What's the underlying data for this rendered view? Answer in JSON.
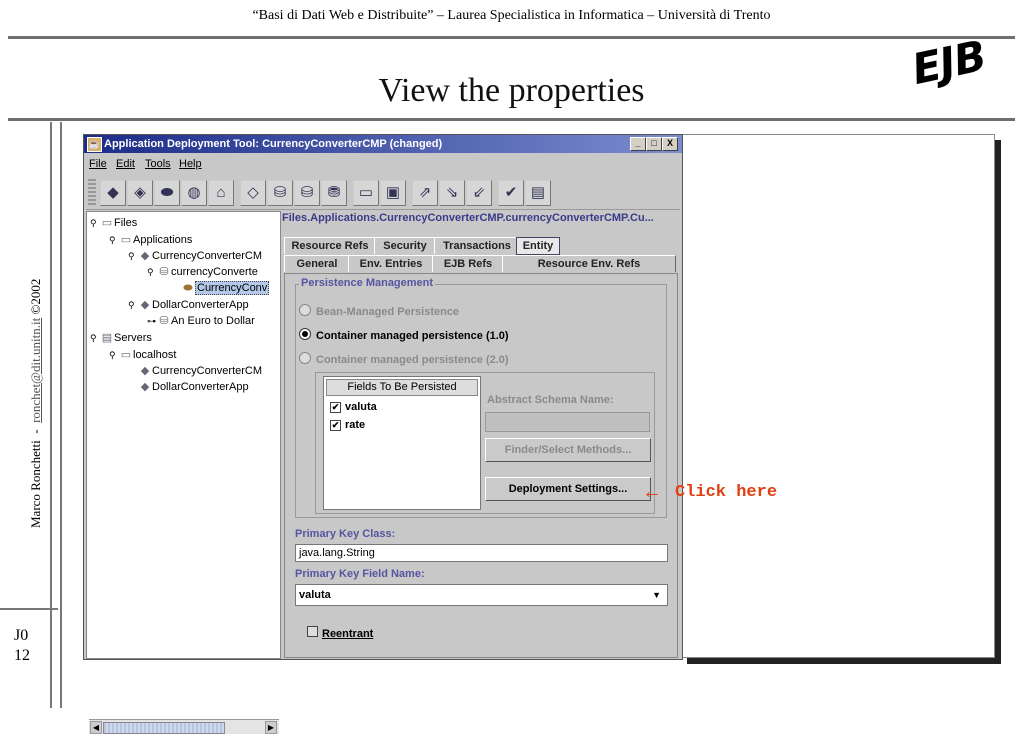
{
  "slide": {
    "course_header": "“Basi di Dati Web e Distribuite” – Laurea Specialistica in Informatica – Università di Trento",
    "title": "View the properties",
    "logo": "EJB",
    "author": "Marco Ronchetti",
    "author_email": "ronchet@dit.unitn.it",
    "copyright": "©2002",
    "separator": "-",
    "code_line1": "J0",
    "code_line2": "12"
  },
  "window": {
    "title": "Application Deployment Tool: CurrencyConverterCMP (changed)",
    "controls": {
      "minimize": "_",
      "maximize": "□",
      "close": "X"
    },
    "menu": [
      "File",
      "Edit",
      "Tools",
      "Help"
    ]
  },
  "tree": {
    "files": "Files",
    "applications": "Applications",
    "app1": "CurrencyConverterCM",
    "jar1": "currencyConverte",
    "bean1": "CurrencyConv",
    "app2": "DollarConverterApp",
    "jar2": "An Euro to Dollar",
    "servers": "Servers",
    "localhost": "localhost",
    "srv_app1": "CurrencyConverterCM",
    "srv_app2": "DollarConverterApp"
  },
  "detail": {
    "path": "Files.Applications.CurrencyConverterCMP.currencyConverterCMP.Cu...",
    "tabs_row1": [
      "Resource Refs",
      "Security",
      "Transactions",
      "Entity"
    ],
    "tabs_row2": [
      "General",
      "Env. Entries",
      "EJB Refs",
      "Resource Env. Refs"
    ],
    "active_tab": "Entity",
    "section_title": "Persistence Management",
    "radio_bean": "Bean-Managed Persistence",
    "radio_cmp10": "Container managed persistence (1.0)",
    "radio_cmp20": "Container managed persistence (2.0)",
    "fields_header": "Fields To Be Persisted",
    "fields": [
      "valuta",
      "rate"
    ],
    "abstract_schema_label": "Abstract Schema Name:",
    "finder_button": "Finder/Select Methods...",
    "deployment_button": "Deployment Settings...",
    "primary_key_class_label": "Primary Key Class:",
    "primary_key_class_value": "java.lang.String",
    "primary_key_field_label": "Primary Key Field Name:",
    "primary_key_field_value": "valuta",
    "reentrant_label": "Reentrant"
  },
  "annotation": {
    "arrow": "←",
    "text": "Click here",
    "color": "#e04010"
  }
}
